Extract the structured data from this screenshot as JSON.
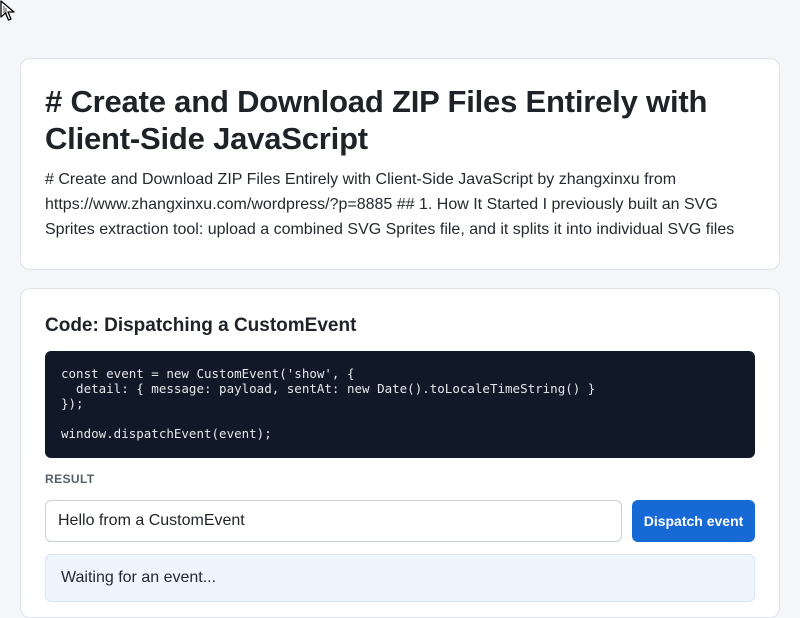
{
  "article": {
    "title": "# Create and Download ZIP Files Entirely with Client-Side JavaScript",
    "summary": "# Create and Download ZIP Files Entirely with Client-Side JavaScript by zhangxinxu from https://www.zhangxinxu.com/wordpress/?p=8885 ## 1. How It Started I previously built an SVG Sprites extraction tool: upload a combined SVG Sprites file, and it splits it into individual SVG files"
  },
  "demo": {
    "section_title": "Code: Dispatching a CustomEvent",
    "code": "const event = new CustomEvent('show', {\n  detail: { message: payload, sentAt: new Date().toLocaleTimeString() }\n});\n\nwindow.dispatchEvent(event);",
    "result_label": "RESULT",
    "input_value": "Hello from a CustomEvent",
    "button_label": "Dispatch event",
    "status_text": "Waiting for an event..."
  },
  "icons": {
    "cursor": "mouse-pointer-icon"
  },
  "colors": {
    "primary": "#1769d6",
    "code_background": "#111827",
    "status_background": "#eef5ff"
  }
}
